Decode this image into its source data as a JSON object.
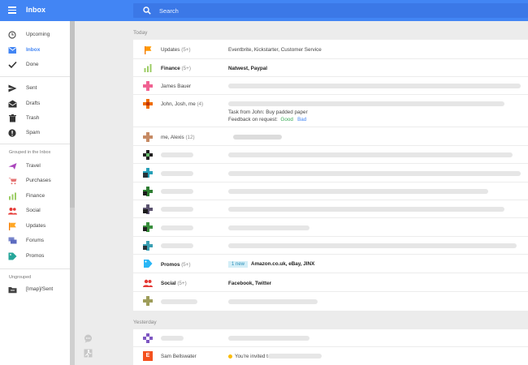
{
  "header": {
    "title": "Inbox",
    "search_placeholder": "Search"
  },
  "sidebar": {
    "items": [
      {
        "label": "Upcoming",
        "icon": "clock-icon"
      },
      {
        "label": "Inbox",
        "icon": "inbox-icon",
        "active": true
      },
      {
        "label": "Done",
        "icon": "check-icon"
      },
      {
        "label": "Sent",
        "icon": "send-icon"
      },
      {
        "label": "Drafts",
        "icon": "drafts-icon"
      },
      {
        "label": "Trash",
        "icon": "trash-icon"
      },
      {
        "label": "Spam",
        "icon": "spam-icon"
      }
    ],
    "groups_label": "Grouped in the Inbox",
    "groups": [
      {
        "label": "Travel",
        "icon": "plane-icon"
      },
      {
        "label": "Purchases",
        "icon": "cart-icon"
      },
      {
        "label": "Finance",
        "icon": "finance-icon"
      },
      {
        "label": "Social",
        "icon": "people-icon"
      },
      {
        "label": "Updates",
        "icon": "flag-icon"
      },
      {
        "label": "Forums",
        "icon": "forums-icon"
      },
      {
        "label": "Promos",
        "icon": "tag-icon"
      }
    ],
    "ungrouped_label": "Ungrouped",
    "ungrouped": [
      {
        "label": "[Imap]/Sent",
        "icon": "folder-icon"
      }
    ]
  },
  "main": {
    "today_label": "Today",
    "yesterday_label": "Yesterday",
    "rows": {
      "updates": {
        "sender": "Updates",
        "count": "(5+)",
        "subject": "Eventbrite, Kickstarter, Customer Service"
      },
      "finance": {
        "sender": "Finance",
        "count": "(5+)",
        "subject": "Natwest, Paypal"
      },
      "james": {
        "sender": "James Bauer"
      },
      "john": {
        "sender": "John, Josh, me",
        "count": "(4)",
        "line1": "Task from John: Buy padded paper",
        "line2": "Feedback on request:",
        "good": "Good",
        "bad": "Bad"
      },
      "alexis": {
        "sender": "me, Alexis",
        "count": "(12)"
      },
      "promos": {
        "sender": "Promos",
        "count": "(5+)",
        "badge": "1 new",
        "subject": "Amazon.co.uk, eBay, JINX"
      },
      "social": {
        "sender": "Social",
        "count": "(5+)",
        "subject": "Facebook, Twitter"
      },
      "sam": {
        "sender": "Sam Bellswater",
        "avatar_letter": "E",
        "subject": "You're invited to"
      }
    }
  },
  "colors": {
    "brand": "#4285f4",
    "search": "#3b78e7",
    "good": "#34a853",
    "promo_badge": "#d3eef7"
  }
}
